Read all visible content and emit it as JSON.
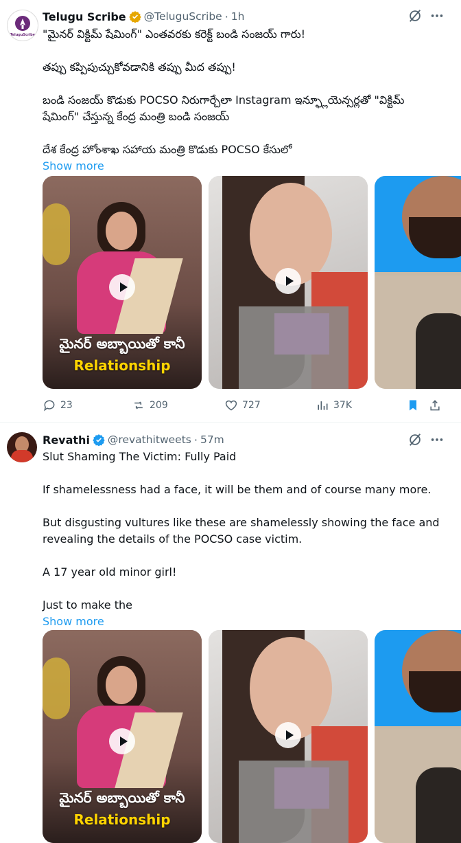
{
  "tweets": [
    {
      "author_name": "Telugu Scribe",
      "handle": "@TeluguScribe",
      "separator": "·",
      "time": "1h",
      "avatar_label": "TeluguScribe",
      "lines": [
        "\"మైనర్ విక్టిమ్ షేమింగ్\" ఎంతవరకు కరెక్ట్ బండి సంజయ్ గారు!",
        "తప్పు కప్పిపుచ్చుకోవడానికి తప్పు మీద తప్పు!",
        "బండి సంజయ్ కొడుకు POCSO నిరుగార్చేలా Instagram ఇన్ఫ్లూయెన్సర్లతో \"విక్టిమ్",
        "షేమింగ్\" చేస్తున్న కేంద్ర మంత్రి బండి సంజయ్",
        "దేశ కేంద్ర హోంశాఖ సహాయ మంత్రి కొడుకు POCSO కేసులో"
      ],
      "show_more": "Show more",
      "media_overlay_te": "మైనర్ అబ్బాయితో కానీ",
      "media_overlay_en": "Relationship",
      "stats": {
        "replies": "23",
        "reposts": "209",
        "likes": "727",
        "views": "37K"
      }
    },
    {
      "author_name": "Revathi",
      "handle": "@revathitweets",
      "separator": "·",
      "time": "57m",
      "lines": [
        "Slut Shaming The Victim: Fully Paid",
        "If shamelessness had a face, it will be them and of course many more.",
        "But disgusting vultures like these are shamelessly showing the face and",
        "revealing the details of the POCSO case victim.",
        "A 17 year old minor girl!",
        "Just to make the"
      ],
      "show_more": "Show more",
      "media_overlay_te": "మైనర్ అబ్బాయితో కానీ",
      "media_overlay_en": "Relationship"
    }
  ],
  "icons": [
    "verified-badge-icon",
    "grok-icon",
    "more-icon",
    "play-icon",
    "reply-icon",
    "repost-icon",
    "like-icon",
    "views-icon",
    "bookmark-icon",
    "share-icon"
  ],
  "colors": {
    "link": "#1d9bf0",
    "verified": "#e6a700",
    "verified_blue": "#1d9bf0",
    "bookmark_active": "#1d9bf0",
    "muted": "#536471"
  }
}
